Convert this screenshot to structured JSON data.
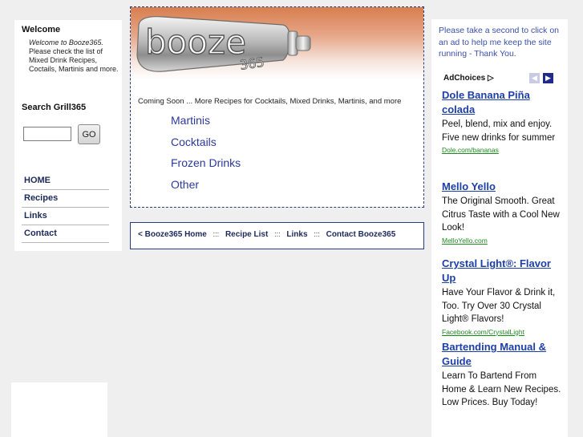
{
  "sidebar": {
    "welcome_title": "Welcome",
    "welcome_intro": "Welcome to Booze365.",
    "welcome_body": "Please check the list of Mixed Drink Recipes, Coctails, Martinis and more.",
    "search_title": "Search Grill365",
    "search_value": "",
    "go_label": "GO",
    "nav": [
      "HOME",
      "Recipes",
      "Links",
      "Contact"
    ]
  },
  "banner": {
    "logo_main": "booze",
    "logo_number": "365"
  },
  "content": {
    "coming_soon": "Coming Soon ... More Recipes for Cocktails, Mixed Drinks, Martinis, and more",
    "recipe_links": [
      "Martinis",
      "Cocktails",
      "Frozen Drinks",
      "Other"
    ]
  },
  "footer": {
    "links": [
      "< Booze365 Home",
      "Recipe List",
      "Links",
      "Contact Booze365"
    ],
    "separator": ":::"
  },
  "ads": {
    "message": "Please take a second to click on an ad to help me keep the site running - Thank You.",
    "adchoices": "AdChoices",
    "items": [
      {
        "title": "Dole Banana Piña colada",
        "body": "Peel, blend, mix and enjoy. Five new drinks for summer",
        "url": "Dole.com/bananas"
      },
      {
        "title": "Mello Yello",
        "body": "The Original Smooth. Great Citrus Taste with a Cool New Look!",
        "url": "MelloYello.com"
      },
      {
        "title": "Crystal Light®: Flavor Up",
        "body": "Have Your Flavor & Drink it, Too. Try Over 30 Crystal Light® Flavors!",
        "url": "Facebook.com/CrystalLight"
      },
      {
        "title": "Bartending Manual & Guide",
        "body": "Learn To Bartend From Home & Learn New Recipes. Low Prices. Buy Today!",
        "url": ""
      }
    ]
  },
  "colors": {
    "link_blue": "#2b3a9a",
    "nav_text": "#1c2a5a",
    "ad_url_green": "#1d8a1d",
    "banner_orange": "#d77e4e"
  }
}
